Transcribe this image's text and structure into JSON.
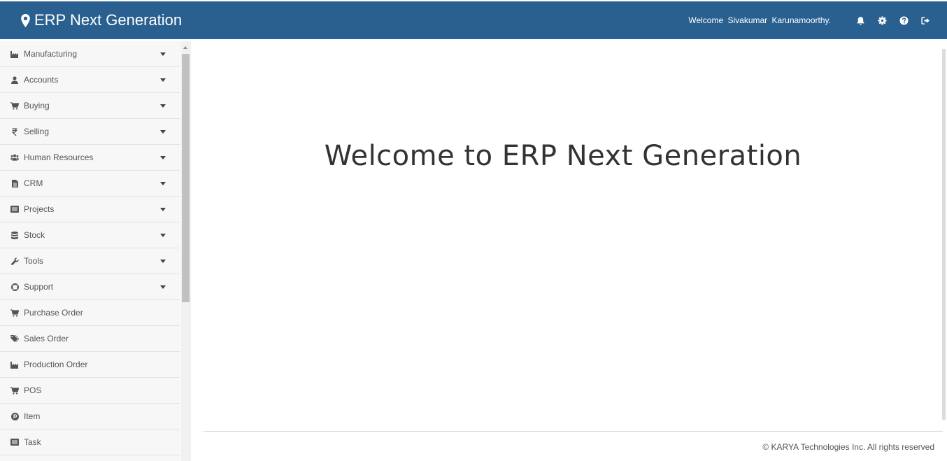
{
  "header": {
    "app_title": "ERP Next Generation",
    "welcome_text": "Welcome  Sivakumar  Karunamoorthy.",
    "background_color": "#2a6090",
    "icons": [
      "map-marker-icon",
      "bell-icon",
      "gear-icon",
      "question-circle-icon",
      "sign-out-icon"
    ]
  },
  "sidebar": {
    "items": [
      {
        "label": "Manufacturing",
        "icon": "industry-icon",
        "expandable": true
      },
      {
        "label": "Accounts",
        "icon": "user-icon",
        "expandable": true
      },
      {
        "label": "Buying",
        "icon": "cart-icon",
        "expandable": true
      },
      {
        "label": "Selling",
        "icon": "rupee-icon",
        "expandable": true
      },
      {
        "label": "Human Resources",
        "icon": "users-icon",
        "expandable": true
      },
      {
        "label": "CRM",
        "icon": "file-icon",
        "expandable": true
      },
      {
        "label": "Projects",
        "icon": "list-icon",
        "expandable": true
      },
      {
        "label": "Stock",
        "icon": "database-icon",
        "expandable": true
      },
      {
        "label": "Tools",
        "icon": "wrench-icon",
        "expandable": true
      },
      {
        "label": "Support",
        "icon": "lifebuoy-icon",
        "expandable": true
      },
      {
        "label": "Purchase Order",
        "icon": "cart-icon",
        "expandable": false
      },
      {
        "label": "Sales Order",
        "icon": "tags-icon",
        "expandable": false
      },
      {
        "label": "Production Order",
        "icon": "industry-icon",
        "expandable": false
      },
      {
        "label": "POS",
        "icon": "cart-icon",
        "expandable": false
      },
      {
        "label": "Item",
        "icon": "product-hunt-icon",
        "expandable": false
      },
      {
        "label": "Task",
        "icon": "list-icon",
        "expandable": false
      }
    ]
  },
  "main": {
    "welcome_title": "Welcome to ERP Next Generation"
  },
  "footer": {
    "text": "© KARYA Technologies Inc. All rights reserved"
  }
}
